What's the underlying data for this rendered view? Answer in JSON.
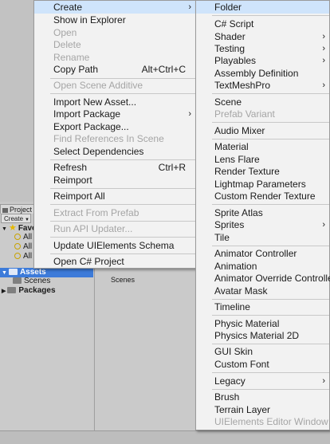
{
  "project": {
    "tab_label": "Project",
    "create_label": "Create",
    "favorites_label": "Favo",
    "favorite_items": [
      "All",
      "All",
      "All"
    ],
    "assets_label": "Assets",
    "scenes_label": "Scenes",
    "packages_label": "Packages",
    "content_scenes_label": "Scenes"
  },
  "main_menu": {
    "create": "Create",
    "show_in_explorer": "Show in Explorer",
    "open": "Open",
    "delete": "Delete",
    "rename": "Rename",
    "copy_path": "Copy Path",
    "copy_path_shortcut": "Alt+Ctrl+C",
    "open_scene_additive": "Open Scene Additive",
    "import_new_asset": "Import New Asset...",
    "import_package": "Import Package",
    "export_package": "Export Package...",
    "find_references": "Find References In Scene",
    "select_dependencies": "Select Dependencies",
    "refresh": "Refresh",
    "refresh_shortcut": "Ctrl+R",
    "reimport": "Reimport",
    "reimport_all": "Reimport All",
    "extract_from_prefab": "Extract From Prefab",
    "run_api_updater": "Run API Updater...",
    "update_uielements_schema": "Update UIElements Schema",
    "open_csharp_project": "Open C# Project"
  },
  "sub_menu": {
    "folder": "Folder",
    "csharp_script": "C# Script",
    "shader": "Shader",
    "testing": "Testing",
    "playables": "Playables",
    "assembly_definition": "Assembly Definition",
    "textmeshpro": "TextMeshPro",
    "scene": "Scene",
    "prefab_variant": "Prefab Variant",
    "audio_mixer": "Audio Mixer",
    "material": "Material",
    "lens_flare": "Lens Flare",
    "render_texture": "Render Texture",
    "lightmap_parameters": "Lightmap Parameters",
    "custom_render_texture": "Custom Render Texture",
    "sprite_atlas": "Sprite Atlas",
    "sprites": "Sprites",
    "tile": "Tile",
    "animator_controller": "Animator Controller",
    "animation": "Animation",
    "animator_override_controller": "Animator Override Controller",
    "avatar_mask": "Avatar Mask",
    "timeline": "Timeline",
    "physic_material": "Physic Material",
    "physics_material_2d": "Physics Material 2D",
    "gui_skin": "GUI Skin",
    "custom_font": "Custom Font",
    "legacy": "Legacy",
    "brush": "Brush",
    "terrain_layer": "Terrain Layer",
    "uielements_editor_window": "UIElements Editor Window"
  },
  "arrow_glyph": "›",
  "colors": {
    "highlight": "#cfe4fb",
    "selection": "#3d7bd9",
    "disabled_text": "#a5a5a5"
  }
}
